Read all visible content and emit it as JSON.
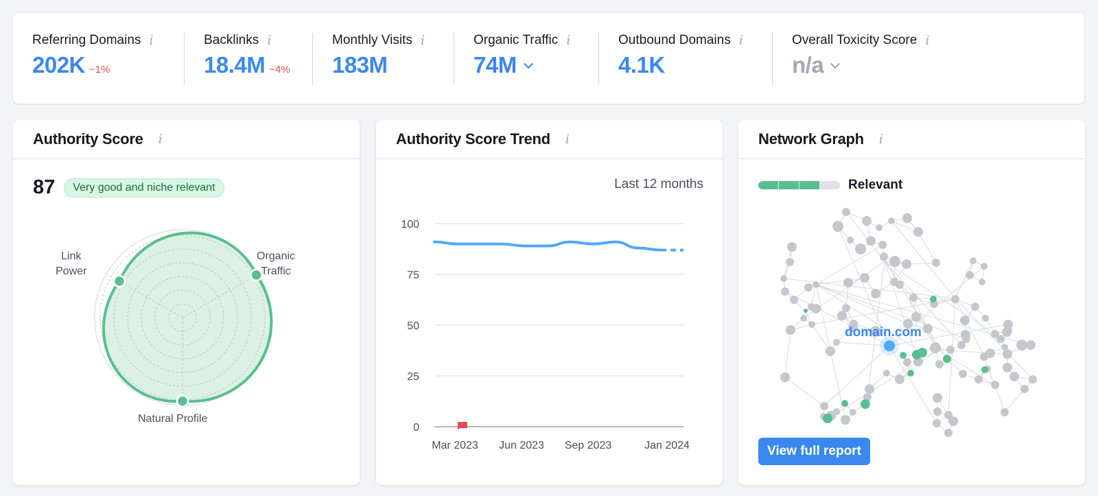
{
  "metrics": [
    {
      "label": "Referring Domains",
      "value": "202K",
      "delta": "−1%",
      "dropdown": false,
      "muted": false
    },
    {
      "label": "Backlinks",
      "value": "18.4M",
      "delta": "−4%",
      "dropdown": false,
      "muted": false
    },
    {
      "label": "Monthly Visits",
      "value": "183M",
      "delta": "",
      "dropdown": false,
      "muted": false
    },
    {
      "label": "Organic Traffic",
      "value": "74M",
      "delta": "",
      "dropdown": true,
      "muted": false
    },
    {
      "label": "Outbound Domains",
      "value": "4.1K",
      "delta": "",
      "dropdown": false,
      "muted": false
    },
    {
      "label": "Overall Toxicity Score",
      "value": "n/a",
      "delta": "",
      "dropdown": true,
      "muted": true
    }
  ],
  "info_icon": "i",
  "authority": {
    "title": "Authority Score",
    "score": "87",
    "badge": "Very good and niche relevant",
    "radar": {
      "axes": [
        {
          "label_lines": [
            "Link",
            "Power"
          ],
          "value": 0.83
        },
        {
          "label_lines": [
            "Organic",
            "Traffic"
          ],
          "value": 0.97
        },
        {
          "label_lines": [
            "Natural Profile"
          ],
          "value": 0.95
        }
      ],
      "rings": 6,
      "color": "#59bf8e"
    }
  },
  "trend": {
    "title": "Authority Score Trend",
    "period": "Last 12 months",
    "chart_data": {
      "type": "line",
      "title": "Authority Score Trend",
      "xlabel": "",
      "ylabel": "",
      "ylim": [
        0,
        100
      ],
      "yticks": [
        0,
        25,
        50,
        75,
        100
      ],
      "xtick_labels": [
        "Mar 2023",
        "Jun 2023",
        "Sep 2023",
        "Jan 2024"
      ],
      "x": [
        "Feb 2023",
        "Mar 2023",
        "Apr 2023",
        "May 2023",
        "Jun 2023",
        "Jul 2023",
        "Aug 2023",
        "Sep 2023",
        "Oct 2023",
        "Nov 2023",
        "Dec 2023",
        "Jan 2024"
      ],
      "series": [
        {
          "name": "Authority Score",
          "values": [
            91,
            90,
            90,
            90,
            89,
            89,
            91,
            90,
            91,
            88,
            87,
            87
          ],
          "dashed_last_segment": true,
          "color": "#52a8f5"
        }
      ],
      "grid": true,
      "annotations": [
        {
          "type": "flag",
          "x": "Mar 2023",
          "color": "#e8484f"
        }
      ]
    }
  },
  "network": {
    "title": "Network Graph",
    "relevance_label": "Relevant",
    "relevance_level": 3,
    "relevance_max": 4,
    "domain_label": "domain.com",
    "button_label": "View full report",
    "colors": {
      "node": "#c5c7cf",
      "relevant": "#59bf8e",
      "domain": "#52a8f5",
      "edge": "#d8dae0"
    }
  }
}
